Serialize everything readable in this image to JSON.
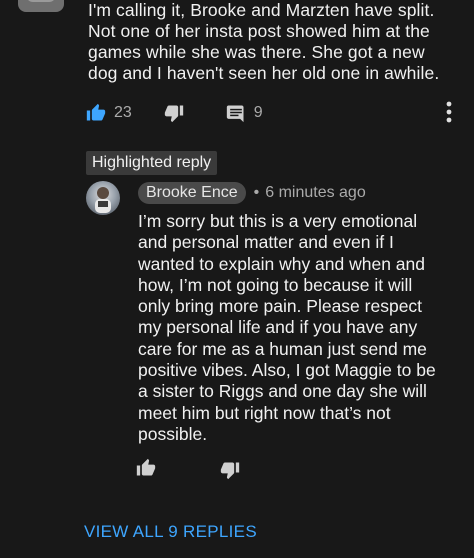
{
  "top_comment": {
    "text": "I'm calling it, Brooke and Marzten have split. Not one of her insta post showed him at the games while she was there. She got a new dog and I haven't seen her old one in awhile.",
    "likes": "23",
    "replies_count": "9"
  },
  "highlighted_label": "Highlighted reply",
  "reply": {
    "author": "Brooke Ence",
    "separator": "•",
    "time": "6 minutes ago",
    "text": "I’m sorry but this is a very emotional and personal matter and even if I wanted to explain why and when and how, I’m not going to because it will only bring more pain. Please respect my personal life and if you have any care for me as a human just send me positive vibes. Also, I got Maggie to be a sister to Riggs and one day she will meet him but right now that’s not possible."
  },
  "view_all_replies": "VIEW ALL 9 REPLIES",
  "colors": {
    "background": "#181818",
    "text": "#f1f1f1",
    "secondary_text": "#aaaaaa",
    "like_active": "#3ea6ff",
    "link": "#3ea6ff"
  },
  "icons": {
    "like": "thumbs-up-icon",
    "dislike": "thumbs-down-icon",
    "reply": "comment-icon",
    "more": "more-vertical-icon"
  }
}
